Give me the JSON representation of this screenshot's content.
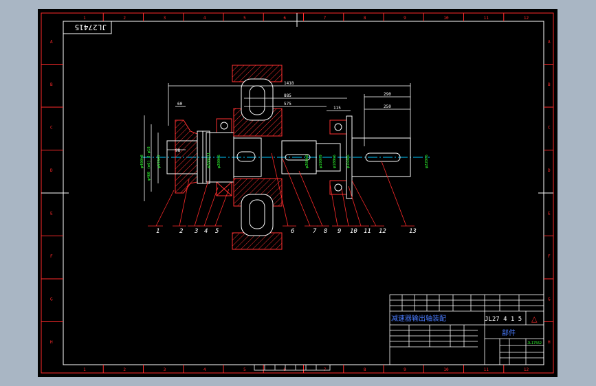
{
  "drawing": {
    "code_box": "JL27415",
    "title_cn": "减速器输出轴装配",
    "drawing_no": "JL27 4 1 5",
    "revision_mark": "△",
    "part_type": "部件",
    "sheet_text": "JL17562"
  },
  "border": {
    "top_zone_numbers": [
      "1",
      "2",
      "3",
      "4",
      "5",
      "6",
      "7",
      "8",
      "9",
      "10",
      "11",
      "12"
    ],
    "side_zone_letters": [
      "A",
      "B",
      "C",
      "D",
      "E",
      "F",
      "G",
      "H"
    ]
  },
  "dimensions": {
    "total_length": "1418",
    "mid_length": "885",
    "seg_575": "575",
    "seg_115": "115",
    "left_60": "60",
    "right_290": "290",
    "right_250": "250",
    "bore_98": "98",
    "dia_400": "φ400h8",
    "dia_460": "φ460 (m6) 2-φ18",
    "dia_370": "φ370H7",
    "dia_200_a": "φ200h11",
    "dia_200_b": "φ200h6",
    "dia_260": "φ260k6",
    "dia_190": "φ190h9",
    "dia_180": "φ180m6",
    "dia_160": "φ160k6",
    "dia_right": "φ220h6"
  },
  "part_labels": [
    "1",
    "2",
    "3",
    "4",
    "5",
    "6",
    "7",
    "8",
    "9",
    "10",
    "11",
    "12",
    "13"
  ],
  "colors": {
    "border": "#ff2a2a",
    "inner_frame": "#ffffff",
    "dimension": "#ffffff",
    "leader": "#ff2a2a",
    "centerline": "#00c8ff",
    "hatch": "#ff3030",
    "green_text": "#30ff30",
    "cyan_text": "#4a7cff",
    "viewport_bg": "#000000"
  }
}
